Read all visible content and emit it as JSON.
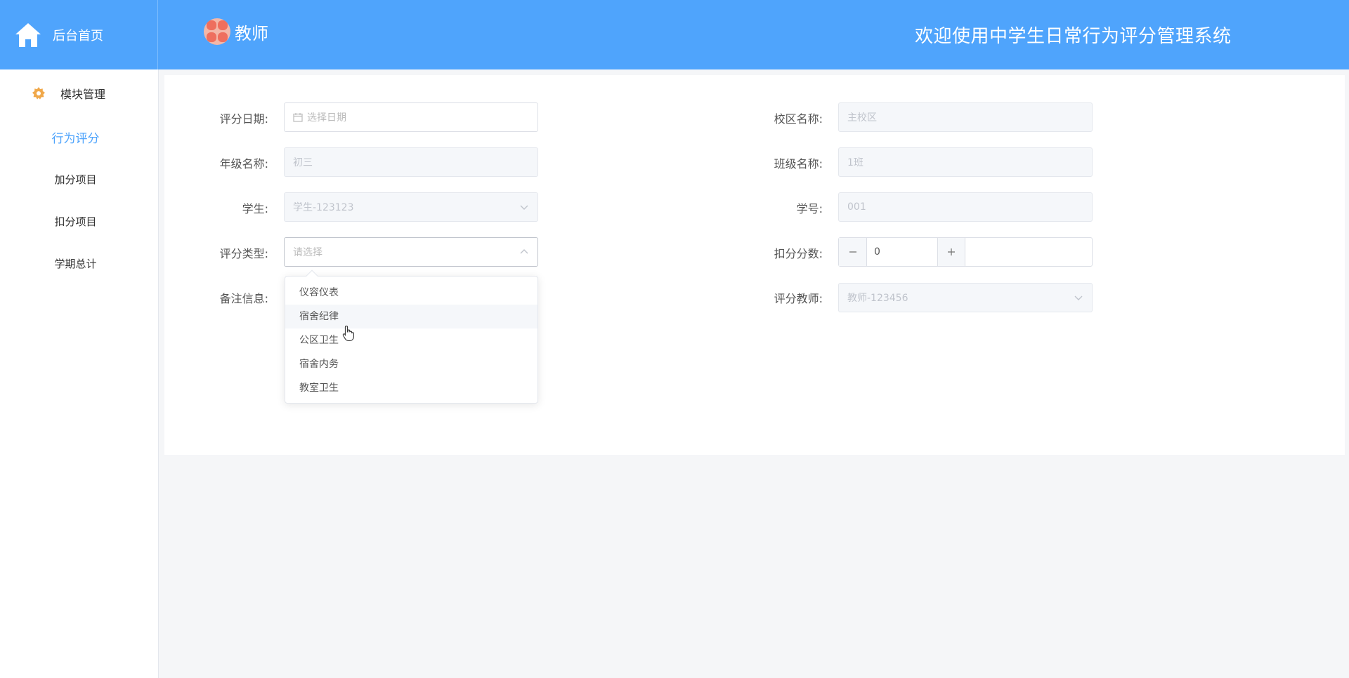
{
  "header": {
    "home_label": "后台首页",
    "user_name": "教师",
    "system_title": "欢迎使用中学生日常行为评分管理系统"
  },
  "sidebar": {
    "group_label": "模块管理",
    "items": [
      {
        "label": "行为评分",
        "active": true
      },
      {
        "label": "加分项目"
      },
      {
        "label": "扣分项目"
      },
      {
        "label": "学期总计"
      }
    ]
  },
  "form": {
    "date_label": "评分日期:",
    "date_placeholder": "选择日期",
    "campus_label": "校区名称:",
    "campus_value": "主校区",
    "grade_label": "年级名称:",
    "grade_value": "初三",
    "class_label": "班级名称:",
    "class_value": "1班",
    "student_label": "学生:",
    "student_value": "学生-123123",
    "student_no_label": "学号:",
    "student_no_value": "001",
    "type_label": "评分类型:",
    "type_placeholder": "请选择",
    "deduct_label": "扣分分数:",
    "deduct_value": "0",
    "remark_label": "备注信息:",
    "teacher_label": "评分教师:",
    "teacher_value": "教师-123456"
  },
  "dropdown": {
    "options": [
      "仪容仪表",
      "宿舍纪律",
      "公区卫生",
      "宿舍内务",
      "教室卫生"
    ],
    "hovered_index": 1
  },
  "colors": {
    "header_bg": "#4fa4fc",
    "accent": "#4fa4fc",
    "page_bg": "#f5f6f8"
  }
}
